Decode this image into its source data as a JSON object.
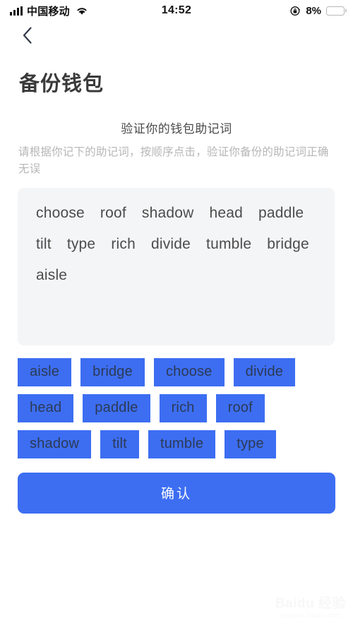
{
  "status_bar": {
    "carrier": "中国移动",
    "time": "14:52",
    "battery_percent": "8%",
    "battery_level": 8,
    "signal_bars": 4,
    "icons": {
      "signal": "signal-bars-icon",
      "wifi": "wifi-icon",
      "rotation_lock": "rotation-lock-icon",
      "battery": "battery-icon"
    }
  },
  "nav": {
    "back_icon": "chevron-left-icon"
  },
  "page": {
    "title": "备份钱包"
  },
  "intro": {
    "title": "验证你的钱包助记词",
    "description": "请根据你记下的助记词，按顺序点击，验证你备份的助记词正确无误"
  },
  "mnemonic_panel": {
    "selected_words": [
      "choose",
      "roof",
      "shadow",
      "head",
      "paddle",
      "tilt",
      "type",
      "rich",
      "divide",
      "tumble",
      "bridge",
      "aisle"
    ]
  },
  "word_bank": {
    "chips": [
      "aisle",
      "bridge",
      "choose",
      "divide",
      "head",
      "paddle",
      "rich",
      "roof",
      "shadow",
      "tilt",
      "tumble",
      "type"
    ]
  },
  "confirm": {
    "label": "确认"
  },
  "watermark": {
    "main": "Baidu 经验",
    "sub": "jingyan.baidu.com"
  },
  "colors": {
    "accent": "#3d6ef2",
    "panel_bg": "#f4f5f7",
    "chip_text": "#2c3a55",
    "title_text": "#3a3a3a",
    "muted_text": "#b6b6b6",
    "battery_low": "#f03a2e"
  }
}
